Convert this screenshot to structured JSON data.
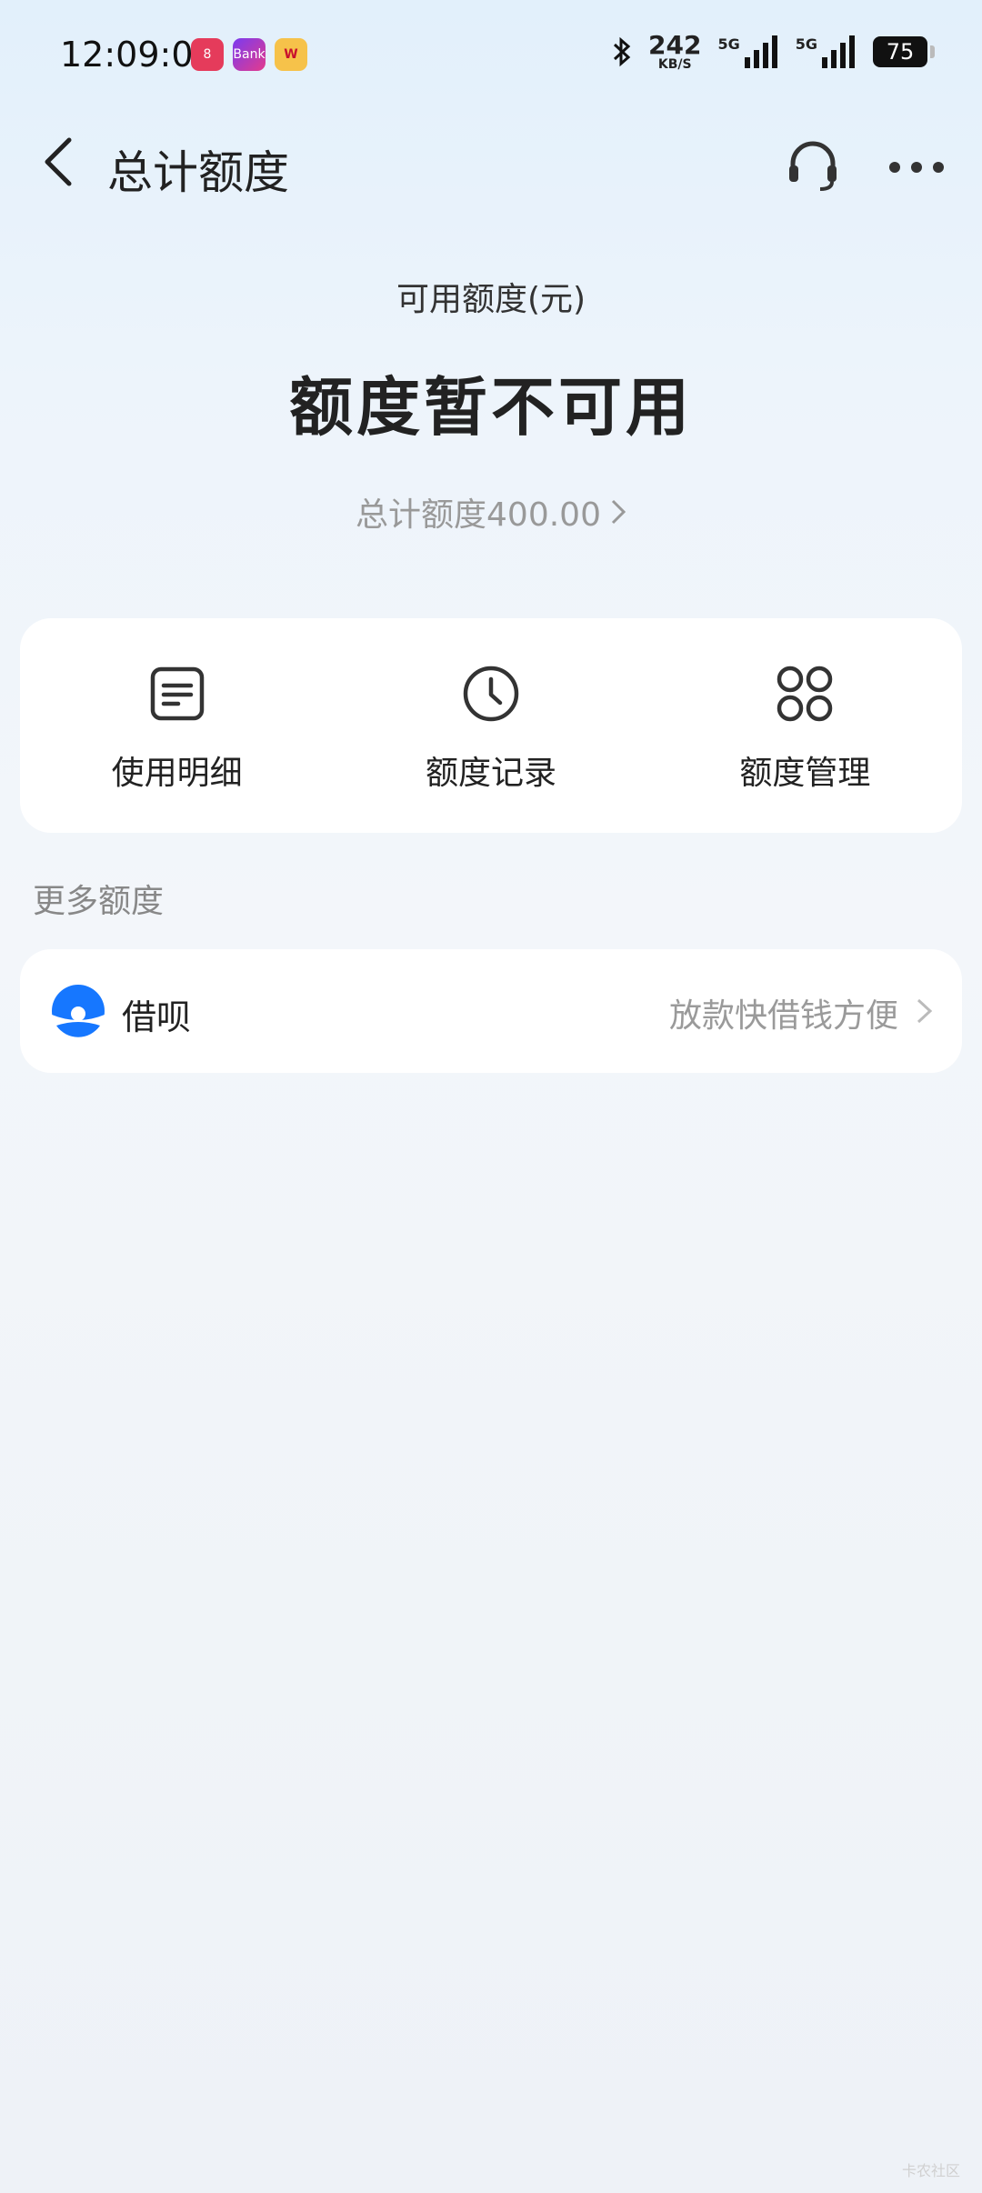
{
  "status_bar": {
    "time": "12:09:00",
    "app_icons": [
      "8",
      "Bank",
      "W"
    ],
    "net_speed_value": "242",
    "net_speed_unit": "KB/S",
    "signal_1_label": "5G",
    "signal_2_label": "5G",
    "battery": "75"
  },
  "nav": {
    "title": "总计额度",
    "back_icon": "chevron-left-icon",
    "service_icon": "headset-icon",
    "more_icon": "more-dots-icon"
  },
  "hero": {
    "available_label": "可用额度(元)",
    "available_status": "额度暂不可用",
    "total_text": "总计额度400.00"
  },
  "actions": [
    {
      "label": "使用明细",
      "icon": "document-icon"
    },
    {
      "label": "额度记录",
      "icon": "clock-icon"
    },
    {
      "label": "额度管理",
      "icon": "grid-icon"
    }
  ],
  "more_section": {
    "title": "更多额度",
    "items": [
      {
        "name": "借呗",
        "desc": "放款快借钱方便",
        "icon": "jiebei-logo-icon"
      }
    ]
  },
  "watermark": "卡农社区",
  "colors": {
    "accent": "#1677ff",
    "muted": "#999999"
  }
}
